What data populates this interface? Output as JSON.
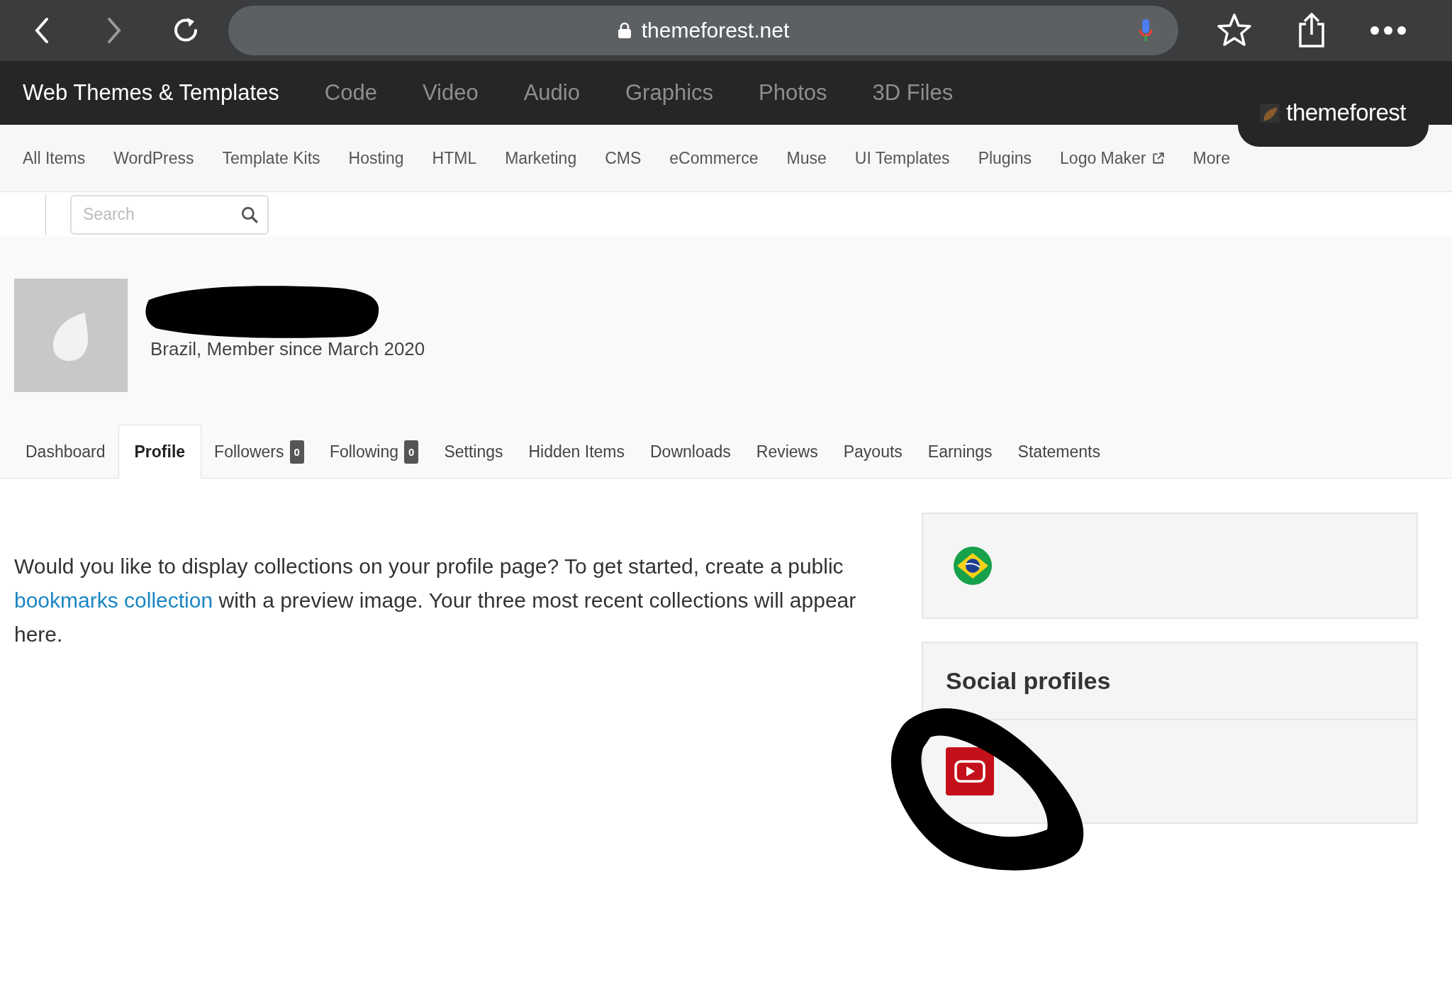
{
  "browser": {
    "url": "themeforest.net"
  },
  "top_nav": {
    "items": [
      {
        "label": "Web Themes & Templates",
        "selected": true
      },
      {
        "label": "Code",
        "selected": false
      },
      {
        "label": "Video",
        "selected": false
      },
      {
        "label": "Audio",
        "selected": false
      },
      {
        "label": "Graphics",
        "selected": false
      },
      {
        "label": "Photos",
        "selected": false
      },
      {
        "label": "3D Files",
        "selected": false
      }
    ],
    "logo": "themeforest"
  },
  "sub_nav": [
    {
      "label": "All Items",
      "external": false
    },
    {
      "label": "WordPress",
      "external": false
    },
    {
      "label": "Template Kits",
      "external": false
    },
    {
      "label": "Hosting",
      "external": false
    },
    {
      "label": "HTML",
      "external": false
    },
    {
      "label": "Marketing",
      "external": false
    },
    {
      "label": "CMS",
      "external": false
    },
    {
      "label": "eCommerce",
      "external": false
    },
    {
      "label": "Muse",
      "external": false
    },
    {
      "label": "UI Templates",
      "external": false
    },
    {
      "label": "Plugins",
      "external": false
    },
    {
      "label": "Logo Maker",
      "external": true
    },
    {
      "label": "More",
      "external": false
    }
  ],
  "search": {
    "placeholder": "Search"
  },
  "profile": {
    "location_line": "Brazil, Member since March 2020"
  },
  "tabs": [
    {
      "label": "Dashboard",
      "selected": false
    },
    {
      "label": "Profile",
      "selected": true
    },
    {
      "label": "Followers",
      "count": "0",
      "selected": false
    },
    {
      "label": "Following",
      "count": "0",
      "selected": false
    },
    {
      "label": "Settings",
      "selected": false
    },
    {
      "label": "Hidden Items",
      "selected": false
    },
    {
      "label": "Downloads",
      "selected": false
    },
    {
      "label": "Reviews",
      "selected": false
    },
    {
      "label": "Payouts",
      "selected": false
    },
    {
      "label": "Earnings",
      "selected": false
    },
    {
      "label": "Statements",
      "selected": false
    }
  ],
  "collections_message": {
    "before": "Would you like to display collections on your profile page? To get started, create a public ",
    "link": "bookmarks collection",
    "after": " with a preview image. Your three most recent collections will appear here."
  },
  "social_profiles": {
    "title": "Social profiles"
  }
}
